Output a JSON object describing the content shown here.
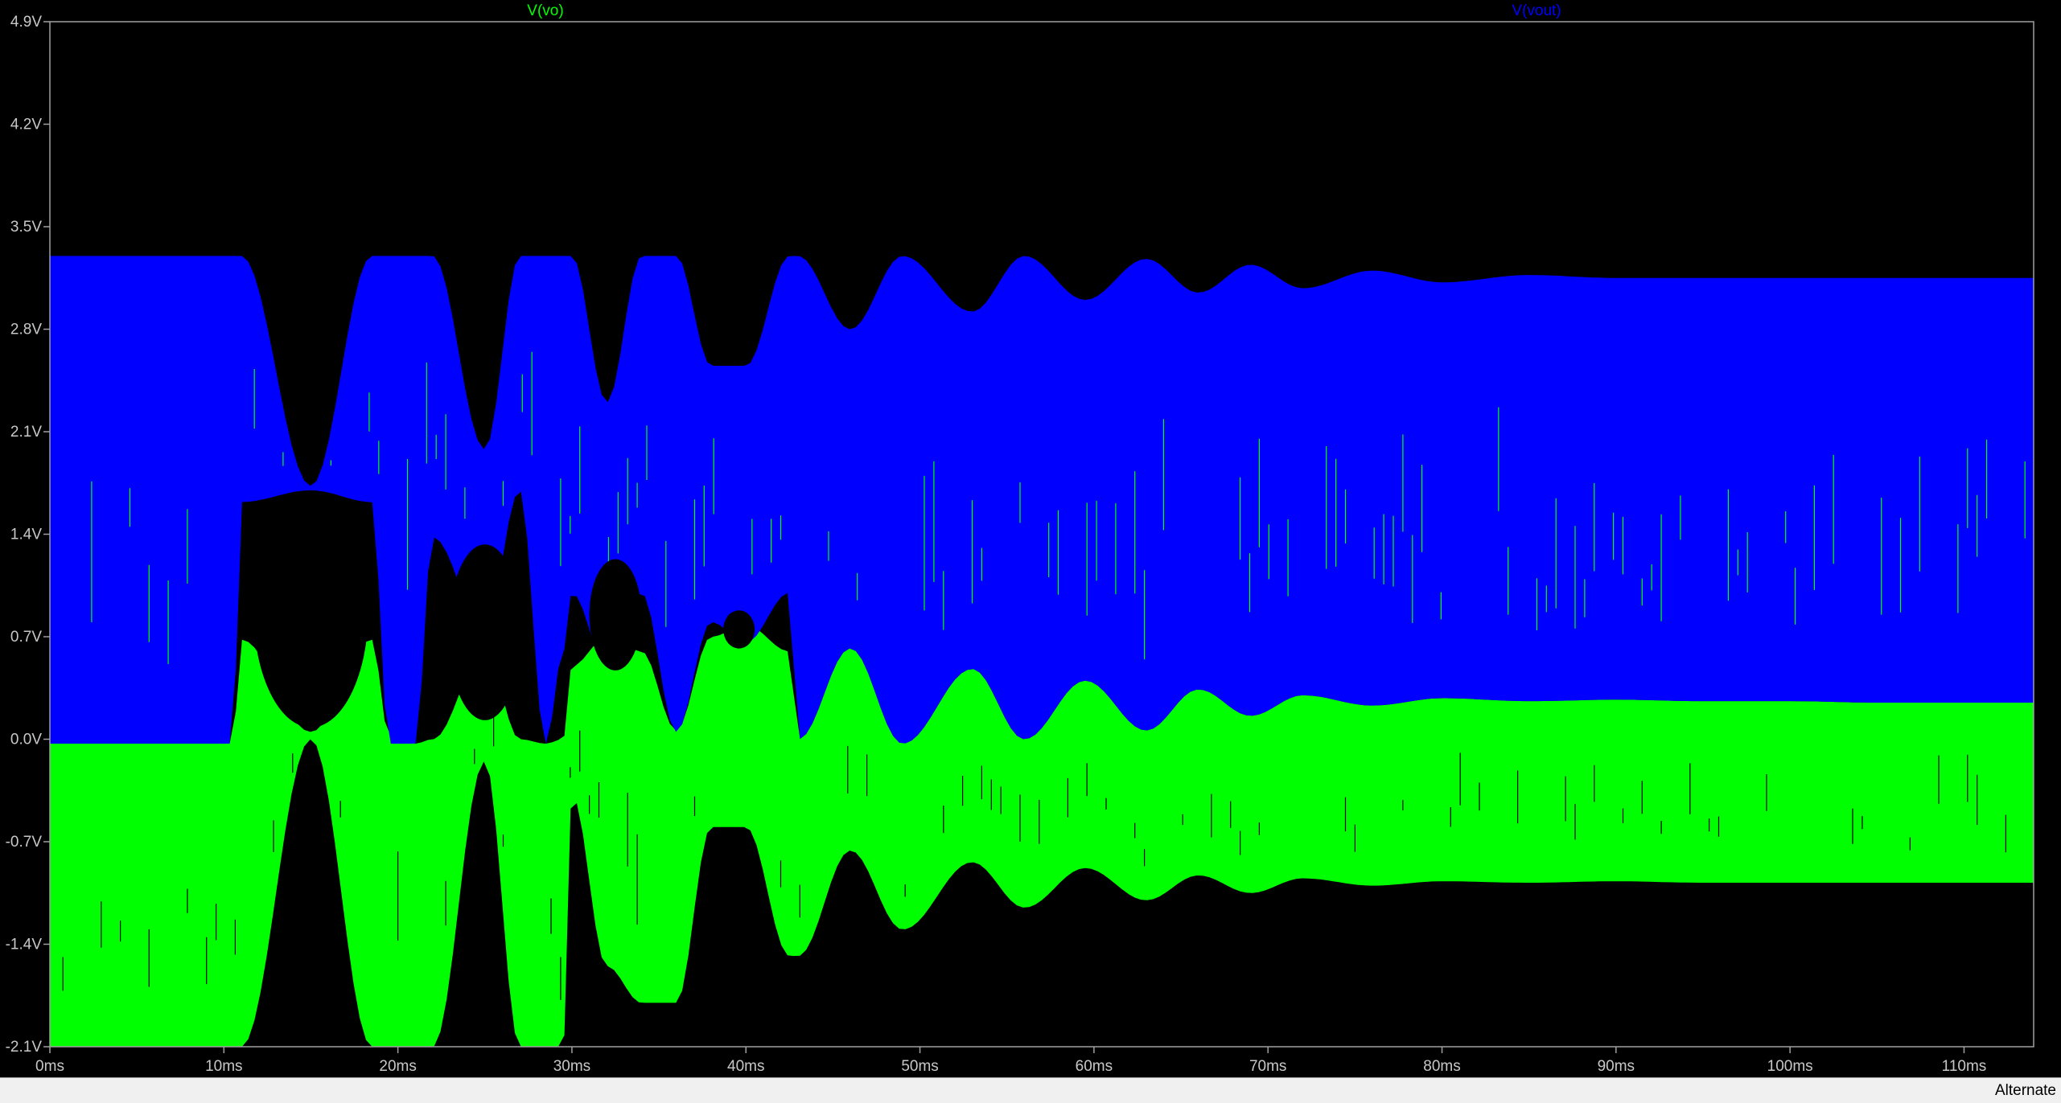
{
  "status_bar": {
    "text": "Alternate"
  },
  "chart_data": {
    "type": "line",
    "title": "",
    "xlabel": "",
    "ylabel": "",
    "xlim": [
      0,
      114
    ],
    "ylim": [
      -2.1,
      4.9
    ],
    "grid": false,
    "background": "#000000",
    "axis_color": "#a0a0a0",
    "x_ticks": [
      {
        "value": 0,
        "label": "0ms"
      },
      {
        "value": 10,
        "label": "10ms"
      },
      {
        "value": 20,
        "label": "20ms"
      },
      {
        "value": 30,
        "label": "30ms"
      },
      {
        "value": 40,
        "label": "40ms"
      },
      {
        "value": 50,
        "label": "50ms"
      },
      {
        "value": 60,
        "label": "60ms"
      },
      {
        "value": 70,
        "label": "70ms"
      },
      {
        "value": 80,
        "label": "80ms"
      },
      {
        "value": 90,
        "label": "90ms"
      },
      {
        "value": 100,
        "label": "100ms"
      },
      {
        "value": 110,
        "label": "110ms"
      }
    ],
    "y_ticks": [
      {
        "value": 4.9,
        "label": "4.9V"
      },
      {
        "value": 4.2,
        "label": "4.2V"
      },
      {
        "value": 3.5,
        "label": "3.5V"
      },
      {
        "value": 2.8,
        "label": "2.8V"
      },
      {
        "value": 2.1,
        "label": "2.1V"
      },
      {
        "value": 1.4,
        "label": "1.4V"
      },
      {
        "value": 0.7,
        "label": "0.7V"
      },
      {
        "value": 0.0,
        "label": "0.0V"
      },
      {
        "value": -0.7,
        "label": "-0.7V"
      },
      {
        "value": -1.4,
        "label": "-1.4V"
      },
      {
        "value": -2.1,
        "label": "-2.1V"
      }
    ],
    "series": [
      {
        "name": "V(vo)",
        "color": "#00ff00",
        "envelope": {
          "x": [
            0,
            10.5,
            11,
            15,
            18.5,
            19.5,
            21,
            22,
            25,
            27,
            28.5,
            29.5,
            30,
            32,
            34,
            36,
            38,
            40,
            42.5,
            43,
            46,
            49,
            53,
            56,
            59.5,
            63,
            66,
            69,
            72,
            76,
            80,
            85,
            90,
            95,
            100,
            105,
            110,
            114
          ],
          "upper": [
            -0.03,
            -0.03,
            0.68,
            0.05,
            0.68,
            0.02,
            -0.03,
            0.0,
            0.6,
            0.0,
            -0.03,
            0.0,
            0.5,
            0.7,
            0.6,
            0.06,
            0.7,
            0.78,
            0.6,
            0.0,
            0.62,
            -0.03,
            0.48,
            0.0,
            0.4,
            0.06,
            0.34,
            0.16,
            0.3,
            0.23,
            0.28,
            0.26,
            0.27,
            0.26,
            0.26,
            0.25,
            0.25,
            0.25
          ],
          "lower": [
            -2.1,
            -2.1,
            -2.1,
            0.0,
            -2.1,
            -2.1,
            -2.1,
            -2.1,
            -0.15,
            -2.1,
            -2.1,
            -2.1,
            -0.38,
            -1.55,
            -1.8,
            -1.8,
            -0.6,
            -0.6,
            -1.48,
            -1.48,
            -0.76,
            -1.3,
            -0.84,
            -1.15,
            -0.88,
            -1.1,
            -0.93,
            -1.05,
            -0.95,
            -1.0,
            -0.97,
            -0.98,
            -0.97,
            -0.98,
            -0.98,
            -0.98,
            -0.98,
            -0.98
          ]
        }
      },
      {
        "name": "V(vout)",
        "color": "#0000ff",
        "envelope": {
          "x": [
            0,
            10.5,
            11,
            15,
            18.5,
            19.5,
            21,
            22,
            25,
            27,
            28.5,
            29.5,
            30,
            32,
            34,
            36,
            38,
            40,
            42.5,
            43,
            46,
            49,
            53,
            56,
            59.5,
            63,
            66,
            69,
            72,
            76,
            80,
            85,
            90,
            95,
            100,
            105,
            110,
            114
          ],
          "upper": [
            3.3,
            3.3,
            3.3,
            1.73,
            3.3,
            3.3,
            3.3,
            3.3,
            1.98,
            3.3,
            3.3,
            3.3,
            3.3,
            2.3,
            3.3,
            3.3,
            2.55,
            2.55,
            3.3,
            3.3,
            2.8,
            3.3,
            2.92,
            3.3,
            3.0,
            3.28,
            3.05,
            3.24,
            3.08,
            3.2,
            3.12,
            3.17,
            3.15,
            3.15,
            3.15,
            3.15,
            3.15,
            3.15
          ],
          "lower": [
            -0.03,
            -0.03,
            1.62,
            1.7,
            1.62,
            -0.03,
            -0.03,
            1.38,
            0.75,
            1.7,
            -0.03,
            0.6,
            1.0,
            0.5,
            1.0,
            0.05,
            0.8,
            0.66,
            1.0,
            0.0,
            0.62,
            -0.03,
            0.48,
            0.0,
            0.4,
            0.06,
            0.34,
            0.16,
            0.3,
            0.23,
            0.28,
            0.26,
            0.27,
            0.26,
            0.26,
            0.25,
            0.25,
            0.25
          ]
        }
      }
    ],
    "holes": [
      {
        "series": "V(vo)",
        "center_x": 15.0,
        "center_y": 0.88,
        "half_width_x": 3.3,
        "half_height_y": 0.8
      },
      {
        "series": "V(vo)",
        "center_x": 25.0,
        "center_y": 0.73,
        "half_width_x": 2.1,
        "half_height_y": 0.6
      },
      {
        "series": "V(vo)",
        "center_x": 32.5,
        "center_y": 0.85,
        "half_width_x": 1.5,
        "half_height_y": 0.38
      },
      {
        "series": "V(vo)",
        "center_x": 39.6,
        "center_y": 0.75,
        "half_width_x": 0.9,
        "half_height_y": 0.13
      }
    ]
  }
}
